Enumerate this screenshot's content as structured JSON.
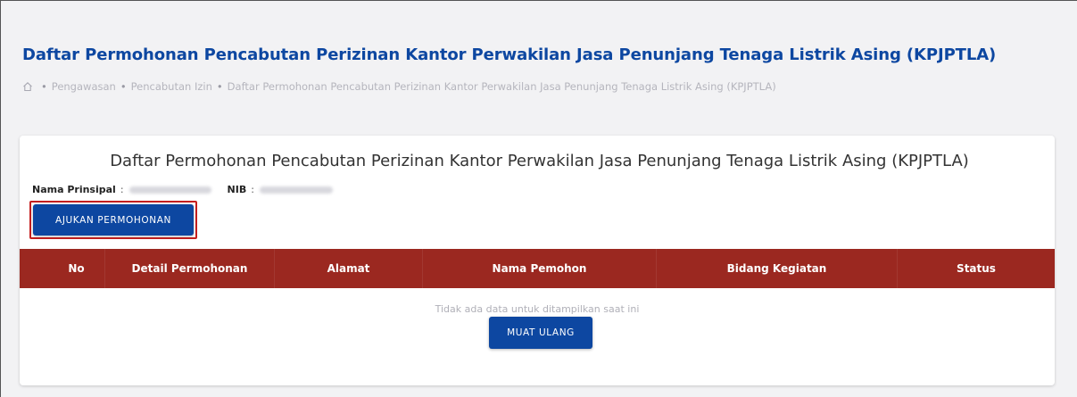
{
  "header": {
    "title": "Daftar Permohonan Pencabutan Perizinan Kantor Perwakilan Jasa Penunjang Tenaga Listrik Asing (KPJPTLA)",
    "breadcrumb": [
      "Pengawasan",
      "Pencabutan Izin",
      "Daftar Permohonan Pencabutan Perizinan Kantor Perwakilan Jasa Penunjang Tenaga Listrik Asing (KPJPTLA)"
    ],
    "home_icon": "home-icon"
  },
  "card": {
    "title": "Daftar Permohonan Pencabutan Perizinan Kantor Perwakilan Jasa Penunjang Tenaga Listrik Asing (KPJPTLA)",
    "nama_prinsipal_label": "Nama Prinsipal",
    "nib_label": "NIB",
    "separator": ":",
    "submit_button": "AJUKAN PERMOHONAN",
    "table": {
      "columns": [
        "No",
        "Detail Permohonan",
        "Alamat",
        "Nama Pemohon",
        "Bidang Kegiatan",
        "Status"
      ],
      "rows": []
    },
    "empty_message": "Tidak ada data untuk ditampilkan saat ini",
    "reload_button": "MUAT ULANG"
  },
  "colors": {
    "primary": "#0d47a1",
    "table_header": "#9b2820",
    "highlight": "#c41e1e"
  }
}
